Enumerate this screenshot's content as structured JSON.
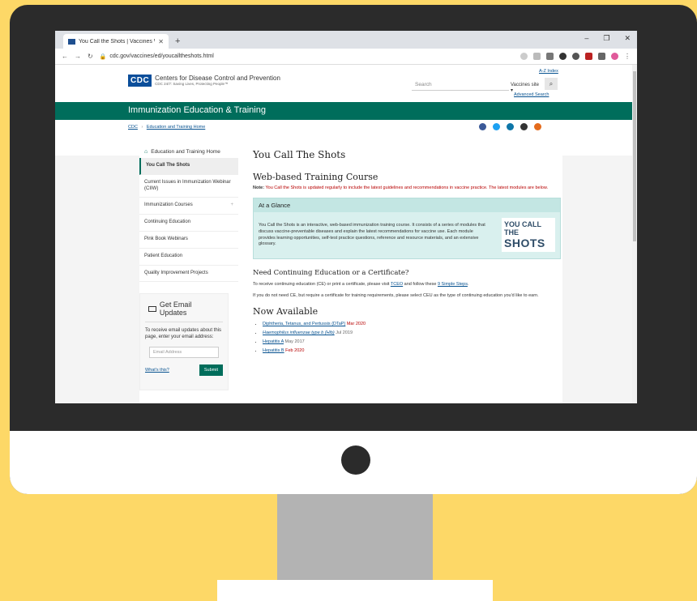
{
  "browser": {
    "tab_title": "You Call the Shots | Vaccines Wr",
    "url": "cdc.gov/vaccines/ed/youcalltheshots.html",
    "win_minimize": "–",
    "win_restore": "❐",
    "win_close": "✕"
  },
  "header": {
    "logo_mark": "CDC",
    "org_name": "Centers for Disease Control and Prevention",
    "tagline": "CDC 24/7: Saving Lives, Protecting People™",
    "search_placeholder": "Search",
    "site_select": "Vaccines site ▾",
    "az_link": "A-Z Index",
    "advanced_search": "Advanced Search"
  },
  "banner_title": "Immunization Education & Training",
  "breadcrumb": {
    "home": "CDC",
    "section": "Education and Training Home"
  },
  "leftnav": {
    "home": "Education and Training Home",
    "items": [
      {
        "label": "You Call The Shots"
      },
      {
        "label": "Current Issues in Immunization Webinar (CIIW)"
      },
      {
        "label": "Immunization Courses"
      },
      {
        "label": "Continuing Education"
      },
      {
        "label": "Pink Book Webinars"
      },
      {
        "label": "Patient Education"
      },
      {
        "label": "Quality Improvement Projects"
      }
    ]
  },
  "email_box": {
    "title": "Get Email Updates",
    "description": "To receive email updates about this page, enter your email address:",
    "placeholder": "Email Address",
    "whats_this": "What's this?",
    "submit": "Submit"
  },
  "main": {
    "title": "You Call The Shots",
    "subtitle": "Web-based Training Course",
    "note_label": "Note:",
    "note_text": "You Call the Shots is updated regularly to include the latest guidelines and recommendations in vaccine practice. The latest modules are below.",
    "glance_header": "At a Glance",
    "glance_text": "You Call the Shots is an interactive, web-based immunization training course. It consists of a series of modules that discuss vaccine-preventable diseases and explain the latest recommendations for vaccine use. Each module provides learning opportunities, self-test practice questions, reference and resource materials, and an extensive glossary.",
    "logo_line1": "YOU CALL THE",
    "logo_line2": "SHOTS",
    "ce_heading": "Need Continuing Education or a Certificate?",
    "ce_p1_a": "To receive continuing education (CE) or print a certificate, please visit ",
    "ce_p1_link1": "TCEO",
    "ce_p1_b": " and follow these ",
    "ce_p1_link2": "9 Simple Steps",
    "ce_p1_c": ".",
    "ce_p2": "If you do not need CE, but require a certificate for training requirements, please select CEU as the type of continuing education you'd like to earn.",
    "now_heading": "Now Available",
    "available": [
      {
        "name": "Diphtheria, Tetanus, and Pertussis (DTaP)",
        "date": "Mar 2020"
      },
      {
        "name": "Haemophilus influenzae type b (Hib)",
        "date": "Jul 2019"
      },
      {
        "name": "Hepatitis A",
        "date": "May 2017"
      },
      {
        "name": "Hepatitis B",
        "date": "Feb 2020"
      }
    ]
  }
}
